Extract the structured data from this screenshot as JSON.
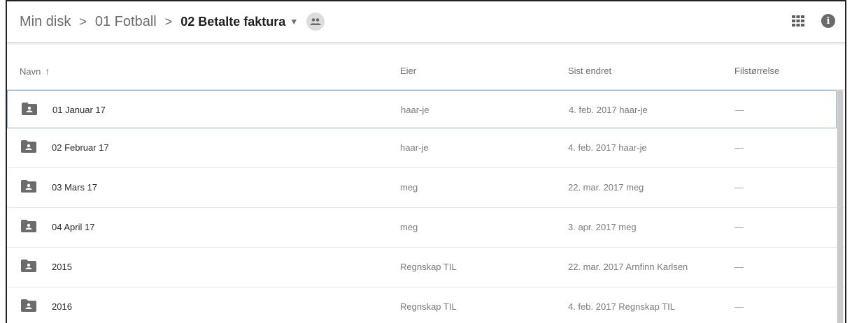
{
  "breadcrumb": {
    "items": [
      "Min disk",
      "01 Fotball"
    ],
    "separator": ">",
    "current": "02 Betalte faktura"
  },
  "icons": {
    "shared": "shared-people-icon",
    "grid": "grid-view-icon",
    "info": "info-icon"
  },
  "columns": {
    "name": "Navn",
    "name_sort": "↑",
    "owner": "Eier",
    "modified": "Sist endret",
    "size": "Filstørrelse"
  },
  "rows": [
    {
      "name": "01 Januar 17",
      "owner": "haar-je",
      "modified": "4. feb. 2017 haar-je",
      "size": "—"
    },
    {
      "name": "02 Februar 17",
      "owner": "haar-je",
      "modified": "4. feb. 2017 haar-je",
      "size": "—"
    },
    {
      "name": "03 Mars 17",
      "owner": "meg",
      "modified": "22. mar. 2017 meg",
      "size": "—"
    },
    {
      "name": "04 April 17",
      "owner": "meg",
      "modified": "3. apr. 2017 meg",
      "size": "—"
    },
    {
      "name": "2015",
      "owner": "Regnskap TIL",
      "modified": "22. mar. 2017 Arnfinn Karlsen",
      "size": "—"
    },
    {
      "name": "2016",
      "owner": "Regnskap TIL",
      "modified": "4. feb. 2017 Regnskap TIL",
      "size": "—"
    }
  ],
  "colors": {
    "selection_border": "#8aaee6",
    "folder_icon": "#6b6b6b"
  }
}
